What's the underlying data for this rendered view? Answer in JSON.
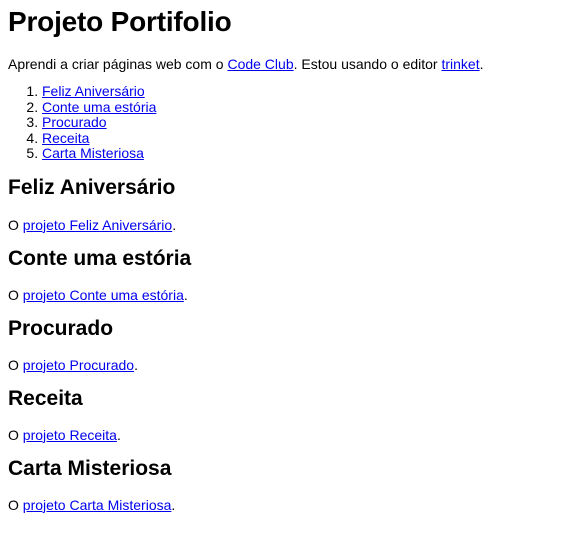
{
  "page": {
    "title": "Projeto Portifolio",
    "intro": {
      "before_code_club": "Aprendi a criar páginas web com o ",
      "code_club_link": "Code Club",
      "middle": ". Estou usando o editor ",
      "trinket_link": "trinket",
      "after": "."
    },
    "toc": [
      "Feliz Aniversário",
      "Conte uma estória",
      "Procurado",
      "Receita",
      "Carta Misteriosa"
    ],
    "sections": [
      {
        "heading": "Feliz Aniversário",
        "prefix": "O ",
        "link": "projeto Feliz Aniversário",
        "suffix": "."
      },
      {
        "heading": "Conte uma estória",
        "prefix": "O ",
        "link": "projeto Conte uma estória",
        "suffix": "."
      },
      {
        "heading": "Procurado",
        "prefix": "O ",
        "link": "projeto Procurado",
        "suffix": "."
      },
      {
        "heading": "Receita",
        "prefix": "O ",
        "link": "projeto Receita",
        "suffix": "."
      },
      {
        "heading": "Carta Misteriosa",
        "prefix": "O ",
        "link": "projeto Carta Misteriosa",
        "suffix": "."
      }
    ]
  },
  "colors": {
    "link": "#0000ee",
    "text": "#000000",
    "background": "#ffffff"
  }
}
